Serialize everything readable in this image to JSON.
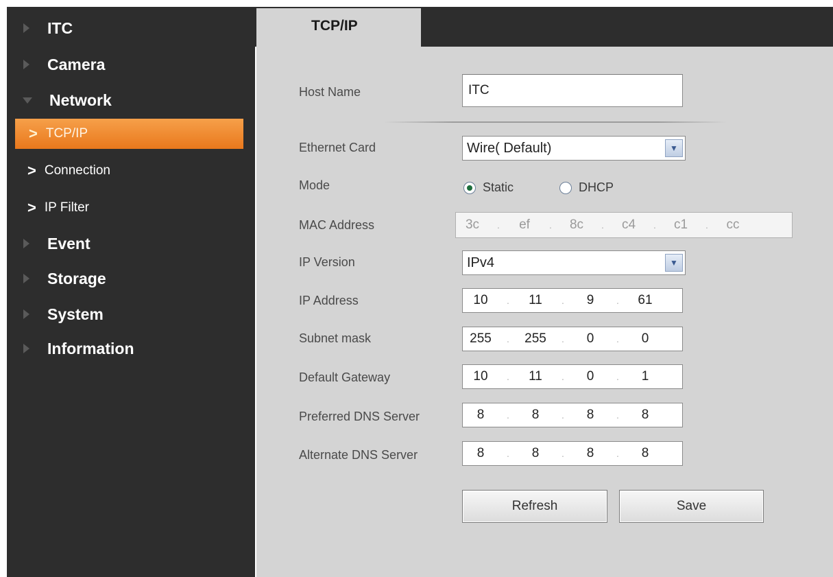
{
  "sidebar": {
    "items": [
      {
        "label": "ITC"
      },
      {
        "label": "Camera"
      },
      {
        "label": "Network"
      },
      {
        "label": "Event"
      },
      {
        "label": "Storage"
      },
      {
        "label": "System"
      },
      {
        "label": "Information"
      }
    ],
    "network_sub": [
      {
        "chevron": ">",
        "label": "TCP/IP"
      },
      {
        "chevron": ">",
        "label": "Connection"
      },
      {
        "chevron": ">",
        "label": "IP Filter"
      }
    ]
  },
  "tab": {
    "label": "TCP/IP"
  },
  "form": {
    "host_name": {
      "label": "Host Name",
      "value": "ITC"
    },
    "ethernet_card": {
      "label": "Ethernet Card",
      "value": "Wire( Default)"
    },
    "mode": {
      "label": "Mode",
      "options": [
        "Static",
        "DHCP"
      ],
      "selected": "Static"
    },
    "mac_address": {
      "label": "MAC Address",
      "octets": [
        "3c",
        "ef",
        "8c",
        "c4",
        "c1",
        "cc"
      ]
    },
    "ip_version": {
      "label": "IP Version",
      "value": "IPv4"
    },
    "ip_address": {
      "label": "IP Address",
      "octets": [
        "10",
        "11",
        "9",
        "61"
      ]
    },
    "subnet_mask": {
      "label": "Subnet mask",
      "octets": [
        "255",
        "255",
        "0",
        "0"
      ]
    },
    "default_gateway": {
      "label": "Default Gateway",
      "octets": [
        "10",
        "11",
        "0",
        "1"
      ]
    },
    "preferred_dns": {
      "label": "Preferred DNS Server",
      "octets": [
        "8",
        "8",
        "8",
        "8"
      ]
    },
    "alternate_dns": {
      "label": "Alternate DNS Server",
      "octets": [
        "8",
        "8",
        "8",
        "8"
      ]
    }
  },
  "buttons": {
    "refresh": "Refresh",
    "save": "Save"
  },
  "colors": {
    "sidebar_bg": "#2d2d2d",
    "active_item": "#ef8a2e",
    "content_bg": "#d4d4d4"
  },
  "icons": {
    "collapsed": "triangle-right-icon",
    "expanded": "triangle-down-icon",
    "dropdown": "chevron-down-icon"
  }
}
